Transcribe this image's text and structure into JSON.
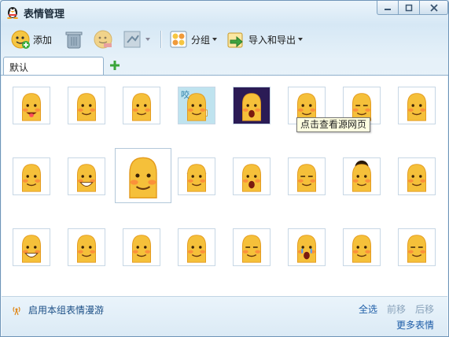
{
  "window": {
    "title": "表情管理",
    "controls": {
      "minimize": "—",
      "maximize": "□",
      "close": "✕"
    }
  },
  "toolbar": {
    "add_label": "添加",
    "group_label": "分组",
    "import_export_label": "导入和导出"
  },
  "tabs": [
    {
      "label": "默认"
    }
  ],
  "tooltip": "点击查看源网页",
  "emoticons": [
    {
      "expression": "tongue"
    },
    {
      "expression": "smile"
    },
    {
      "expression": "smirk"
    },
    {
      "expression": "hold",
      "bg": "blue",
      "text": "咬"
    },
    {
      "expression": "shout",
      "bg": "dark"
    },
    {
      "expression": "blush"
    },
    {
      "expression": "wink"
    },
    {
      "expression": "wave"
    },
    {
      "expression": "shy"
    },
    {
      "expression": "grin"
    },
    {
      "expression": "stare"
    },
    {
      "expression": "helmet"
    },
    {
      "expression": "shock"
    },
    {
      "expression": "doze"
    },
    {
      "expression": "afro"
    },
    {
      "expression": "cool"
    },
    {
      "expression": "laugh"
    },
    {
      "expression": "cheeky"
    },
    {
      "expression": "sweat"
    },
    {
      "expression": "dance"
    },
    {
      "expression": "smug"
    },
    {
      "expression": "cry"
    },
    {
      "expression": "sly"
    },
    {
      "expression": "calm"
    }
  ],
  "footer": {
    "roam_label": "启用本组表情漫游",
    "select_all": "全选",
    "move_forward": "前移",
    "move_back": "后移",
    "more": "更多表情"
  },
  "colors": {
    "face": "#f5c03a",
    "face_dark": "#e39a1d",
    "blush": "#ff6a3a",
    "link": "#1f5ea8"
  }
}
